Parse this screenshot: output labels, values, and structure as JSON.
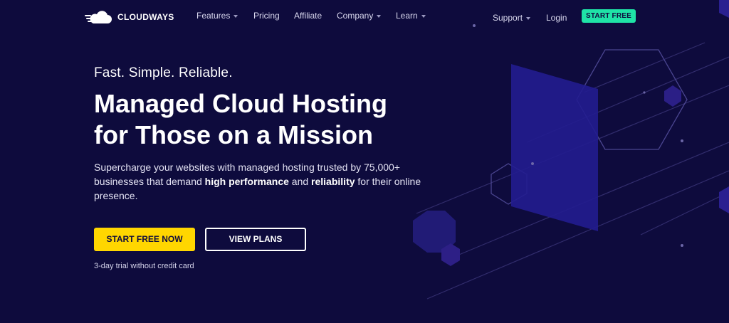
{
  "brand": {
    "name": "CLOUDWAYS"
  },
  "nav": {
    "items": [
      {
        "label": "Features",
        "has_dropdown": true
      },
      {
        "label": "Pricing",
        "has_dropdown": false
      },
      {
        "label": "Affiliate",
        "has_dropdown": false
      },
      {
        "label": "Company",
        "has_dropdown": true
      },
      {
        "label": "Learn",
        "has_dropdown": true
      }
    ],
    "support_label": "Support",
    "login_label": "Login",
    "cta_label": "START FREE"
  },
  "hero": {
    "tagline": "Fast. Simple. Reliable.",
    "headline_line1": "Managed Cloud Hosting",
    "headline_line2": "for Those on a Mission",
    "desc_part1": "Supercharge your websites with managed hosting trusted by 75,000+ businesses that demand ",
    "desc_bold1": "high performance",
    "desc_part2": " and ",
    "desc_bold2": "reliability",
    "desc_part3": " for their online presence.",
    "primary_cta": "START FREE NOW",
    "secondary_cta": "VIEW PLANS",
    "trial_note": "3-day trial without credit card"
  },
  "colors": {
    "background": "#0e0b3d",
    "accent_green": "#1fe3a7",
    "accent_yellow": "#ffd600",
    "panel_purple": "#1f1a8a"
  },
  "icons": [
    "cloud-logo-icon",
    "chevron-down-icon"
  ]
}
